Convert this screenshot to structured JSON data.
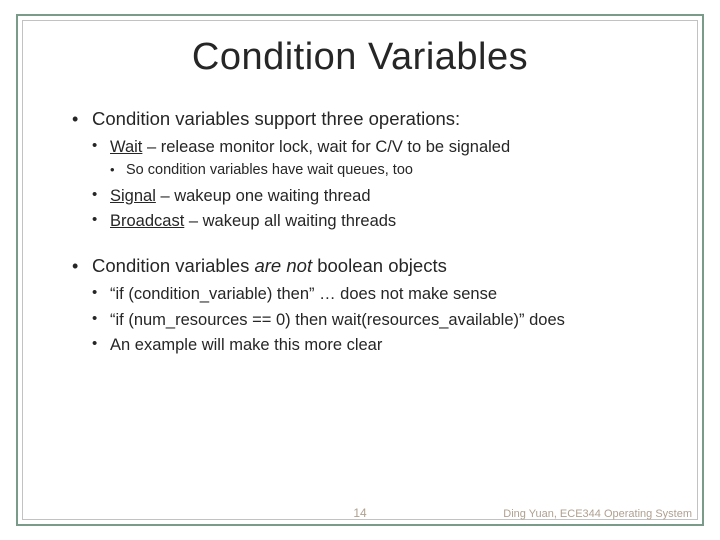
{
  "title": "Condition Variables",
  "bullets": {
    "b1": "Condition variables support three operations:",
    "b1a_key": "Wait",
    "b1a_rest": " – release monitor lock, wait for C/V to be signaled",
    "b1a_sub": "So condition variables have wait queues, too",
    "b1b_key": "Signal",
    "b1b_rest": " – wakeup one waiting thread",
    "b1c_key": "Broadcast",
    "b1c_rest": " – wakeup all waiting threads",
    "b2_pre": "Condition variables ",
    "b2_em": "are not",
    "b2_post": " boolean objects",
    "b2a": "“if (condition_variable) then” … does not make sense",
    "b2b": "“if (num_resources == 0) then wait(resources_available)” does",
    "b2c": "An example will make this more clear"
  },
  "footer": {
    "page": "14",
    "attribution": "Ding Yuan, ECE344 Operating System"
  }
}
